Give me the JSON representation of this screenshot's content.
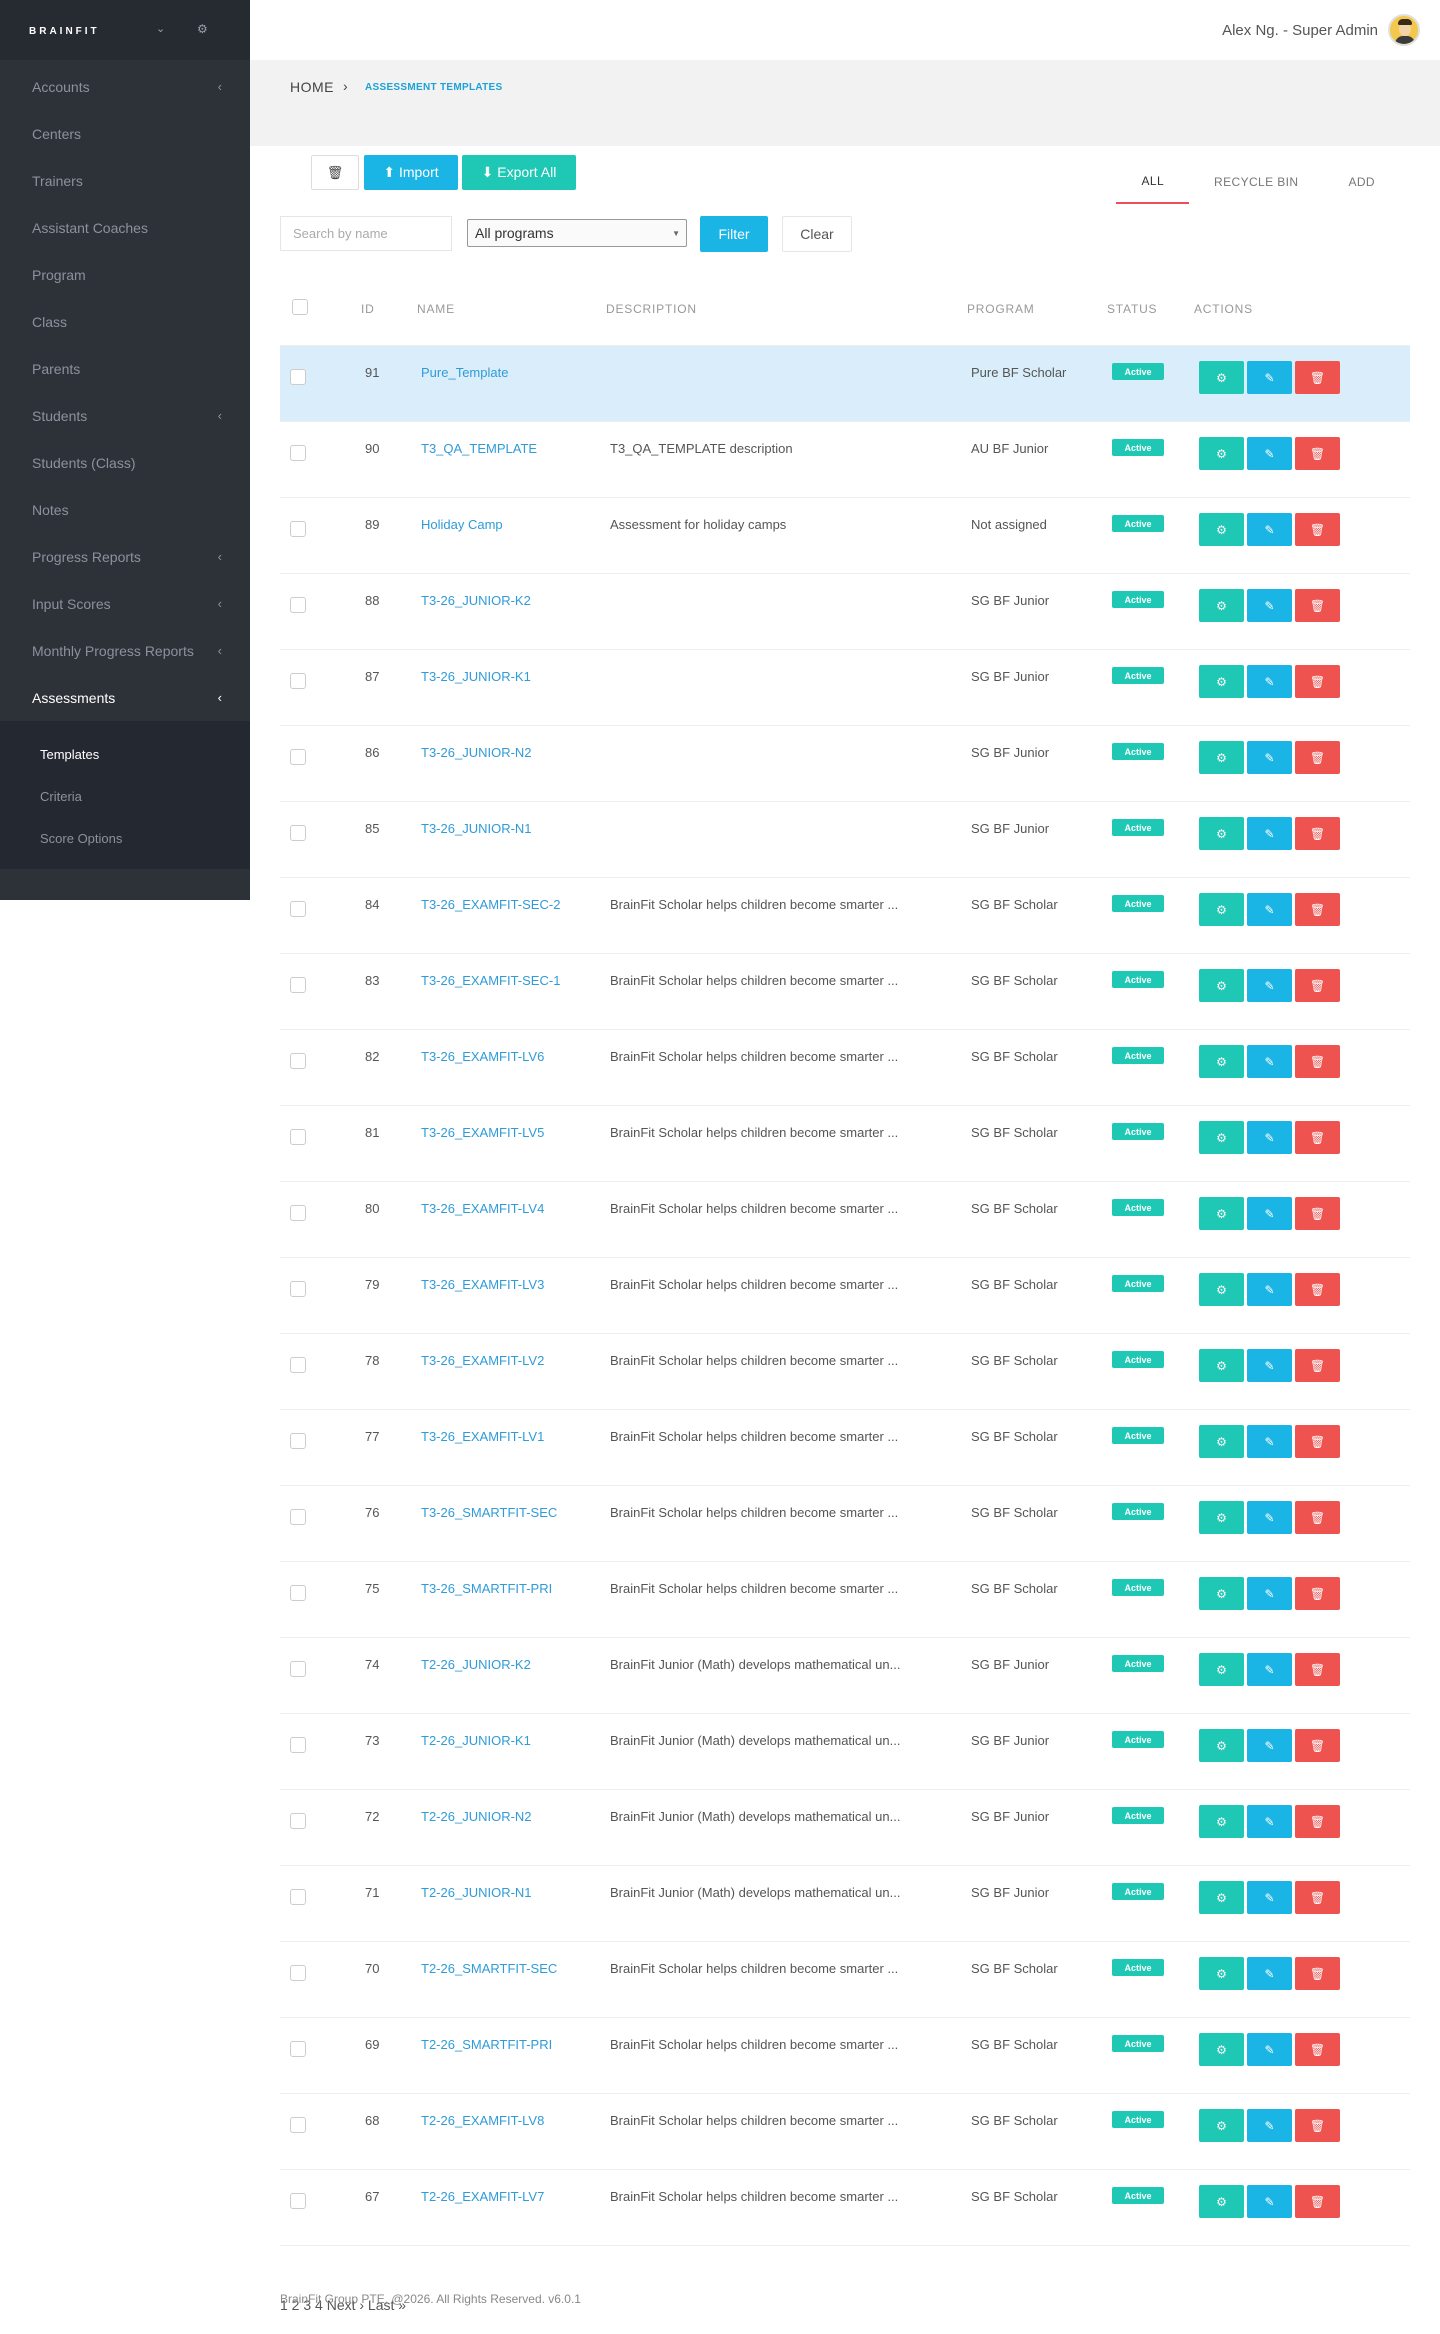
{
  "app": {
    "brand": "BRAINFIT",
    "user": "Alex Ng. - Super Admin"
  },
  "colors": {
    "sidebar_bg": "#2d3239",
    "accent_blue": "#1ab4e5",
    "accent_teal": "#1fc8b5",
    "danger": "#ef5350",
    "tab_underline": "#e8505b",
    "link": "#2f9bd8"
  },
  "sidebar": {
    "items": [
      {
        "label": "Accounts",
        "arrow": "‹"
      },
      {
        "label": "Centers",
        "arrow": ""
      },
      {
        "label": "Trainers",
        "arrow": ""
      },
      {
        "label": "Assistant Coaches",
        "arrow": ""
      },
      {
        "label": "Program",
        "arrow": ""
      },
      {
        "label": "Class",
        "arrow": ""
      },
      {
        "label": "Parents",
        "arrow": ""
      },
      {
        "label": "Students",
        "arrow": "‹"
      },
      {
        "label": "Students (Class)",
        "arrow": ""
      },
      {
        "label": "Notes",
        "arrow": ""
      },
      {
        "label": "Progress Reports",
        "arrow": "‹"
      },
      {
        "label": "Input Scores",
        "arrow": "‹"
      },
      {
        "label": "Monthly Progress Reports",
        "arrow": "‹"
      },
      {
        "label": "Assessments",
        "arrow": "‹"
      }
    ],
    "subitems": [
      {
        "label": "Templates"
      },
      {
        "label": "Criteria"
      },
      {
        "label": "Score Options"
      }
    ]
  },
  "breadcrumb": {
    "home": "HOME",
    "sep": "›",
    "current": "ASSESSMENT TEMPLATES"
  },
  "toolbar": {
    "trash_icon": "🗑",
    "import_label": "⬆ Import",
    "export_label": "⬇ Export All"
  },
  "tabs": [
    "ALL",
    "RECYCLE BIN",
    "ADD"
  ],
  "filter": {
    "search_placeholder": "Search by name",
    "program_selected": "All programs",
    "filter_label": "Filter",
    "clear_label": "Clear"
  },
  "table": {
    "headers": {
      "id": "ID",
      "name": "NAME",
      "description": "DESCRIPTION",
      "program": "PROGRAM",
      "status": "STATUS",
      "actions": "ACTIONS"
    },
    "rows": [
      {
        "id": "91",
        "name": "Pure_Template",
        "description": "",
        "program": "Pure BF Scholar",
        "status": "Active"
      },
      {
        "id": "90",
        "name": "T3_QA_TEMPLATE",
        "description": "T3_QA_TEMPLATE description",
        "program": "AU BF Junior",
        "status": "Active"
      },
      {
        "id": "89",
        "name": "Holiday Camp",
        "description": "Assessment for holiday camps",
        "program": "Not assigned",
        "status": "Active"
      },
      {
        "id": "88",
        "name": "T3-26_JUNIOR-K2",
        "description": "",
        "program": "SG BF Junior",
        "status": "Active"
      },
      {
        "id": "87",
        "name": "T3-26_JUNIOR-K1",
        "description": "",
        "program": "SG BF Junior",
        "status": "Active"
      },
      {
        "id": "86",
        "name": "T3-26_JUNIOR-N2",
        "description": "",
        "program": "SG BF Junior",
        "status": "Active"
      },
      {
        "id": "85",
        "name": "T3-26_JUNIOR-N1",
        "description": "",
        "program": "SG BF Junior",
        "status": "Active"
      },
      {
        "id": "84",
        "name": "T3-26_EXAMFIT-SEC-2",
        "description": "BrainFit Scholar helps children become smarter ...",
        "program": "SG BF Scholar",
        "status": "Active"
      },
      {
        "id": "83",
        "name": "T3-26_EXAMFIT-SEC-1",
        "description": "BrainFit Scholar helps children become smarter ...",
        "program": "SG BF Scholar",
        "status": "Active"
      },
      {
        "id": "82",
        "name": "T3-26_EXAMFIT-LV6",
        "description": "BrainFit Scholar helps children become smarter ...",
        "program": "SG BF Scholar",
        "status": "Active"
      },
      {
        "id": "81",
        "name": "T3-26_EXAMFIT-LV5",
        "description": "BrainFit Scholar helps children become smarter ...",
        "program": "SG BF Scholar",
        "status": "Active"
      },
      {
        "id": "80",
        "name": "T3-26_EXAMFIT-LV4",
        "description": "BrainFit Scholar helps children become smarter ...",
        "program": "SG BF Scholar",
        "status": "Active"
      },
      {
        "id": "79",
        "name": "T3-26_EXAMFIT-LV3",
        "description": "BrainFit Scholar helps children become smarter ...",
        "program": "SG BF Scholar",
        "status": "Active"
      },
      {
        "id": "78",
        "name": "T3-26_EXAMFIT-LV2",
        "description": "BrainFit Scholar helps children become smarter ...",
        "program": "SG BF Scholar",
        "status": "Active"
      },
      {
        "id": "77",
        "name": "T3-26_EXAMFIT-LV1",
        "description": "BrainFit Scholar helps children become smarter ...",
        "program": "SG BF Scholar",
        "status": "Active"
      },
      {
        "id": "76",
        "name": "T3-26_SMARTFIT-SEC",
        "description": "BrainFit Scholar helps children become smarter ...",
        "program": "SG BF Scholar",
        "status": "Active"
      },
      {
        "id": "75",
        "name": "T3-26_SMARTFIT-PRI",
        "description": "BrainFit Scholar helps children become smarter ...",
        "program": "SG BF Scholar",
        "status": "Active"
      },
      {
        "id": "74",
        "name": "T2-26_JUNIOR-K2",
        "description": "BrainFit Junior (Math) develops mathematical un...",
        "program": "SG BF Junior",
        "status": "Active"
      },
      {
        "id": "73",
        "name": "T2-26_JUNIOR-K1",
        "description": "BrainFit Junior (Math) develops mathematical un...",
        "program": "SG BF Junior",
        "status": "Active"
      },
      {
        "id": "72",
        "name": "T2-26_JUNIOR-N2",
        "description": "BrainFit Junior (Math) develops mathematical un...",
        "program": "SG BF Junior",
        "status": "Active"
      },
      {
        "id": "71",
        "name": "T2-26_JUNIOR-N1",
        "description": "BrainFit Junior (Math) develops mathematical un...",
        "program": "SG BF Junior",
        "status": "Active"
      },
      {
        "id": "70",
        "name": "T2-26_SMARTFIT-SEC",
        "description": "BrainFit Scholar helps children become smarter ...",
        "program": "SG BF Scholar",
        "status": "Active"
      },
      {
        "id": "69",
        "name": "T2-26_SMARTFIT-PRI",
        "description": "BrainFit Scholar helps children become smarter ...",
        "program": "SG BF Scholar",
        "status": "Active"
      },
      {
        "id": "68",
        "name": "T2-26_EXAMFIT-LV8",
        "description": "BrainFit Scholar helps children become smarter ...",
        "program": "SG BF Scholar",
        "status": "Active"
      },
      {
        "id": "67",
        "name": "T2-26_EXAMFIT-LV7",
        "description": "BrainFit Scholar helps children become smarter ...",
        "program": "SG BF Scholar",
        "status": "Active"
      }
    ]
  },
  "pagination": "1 2 3 4 Next › Last »",
  "footer": "BrainFit Group PTE. @2026. All Rights Reserved. v6.0.1"
}
